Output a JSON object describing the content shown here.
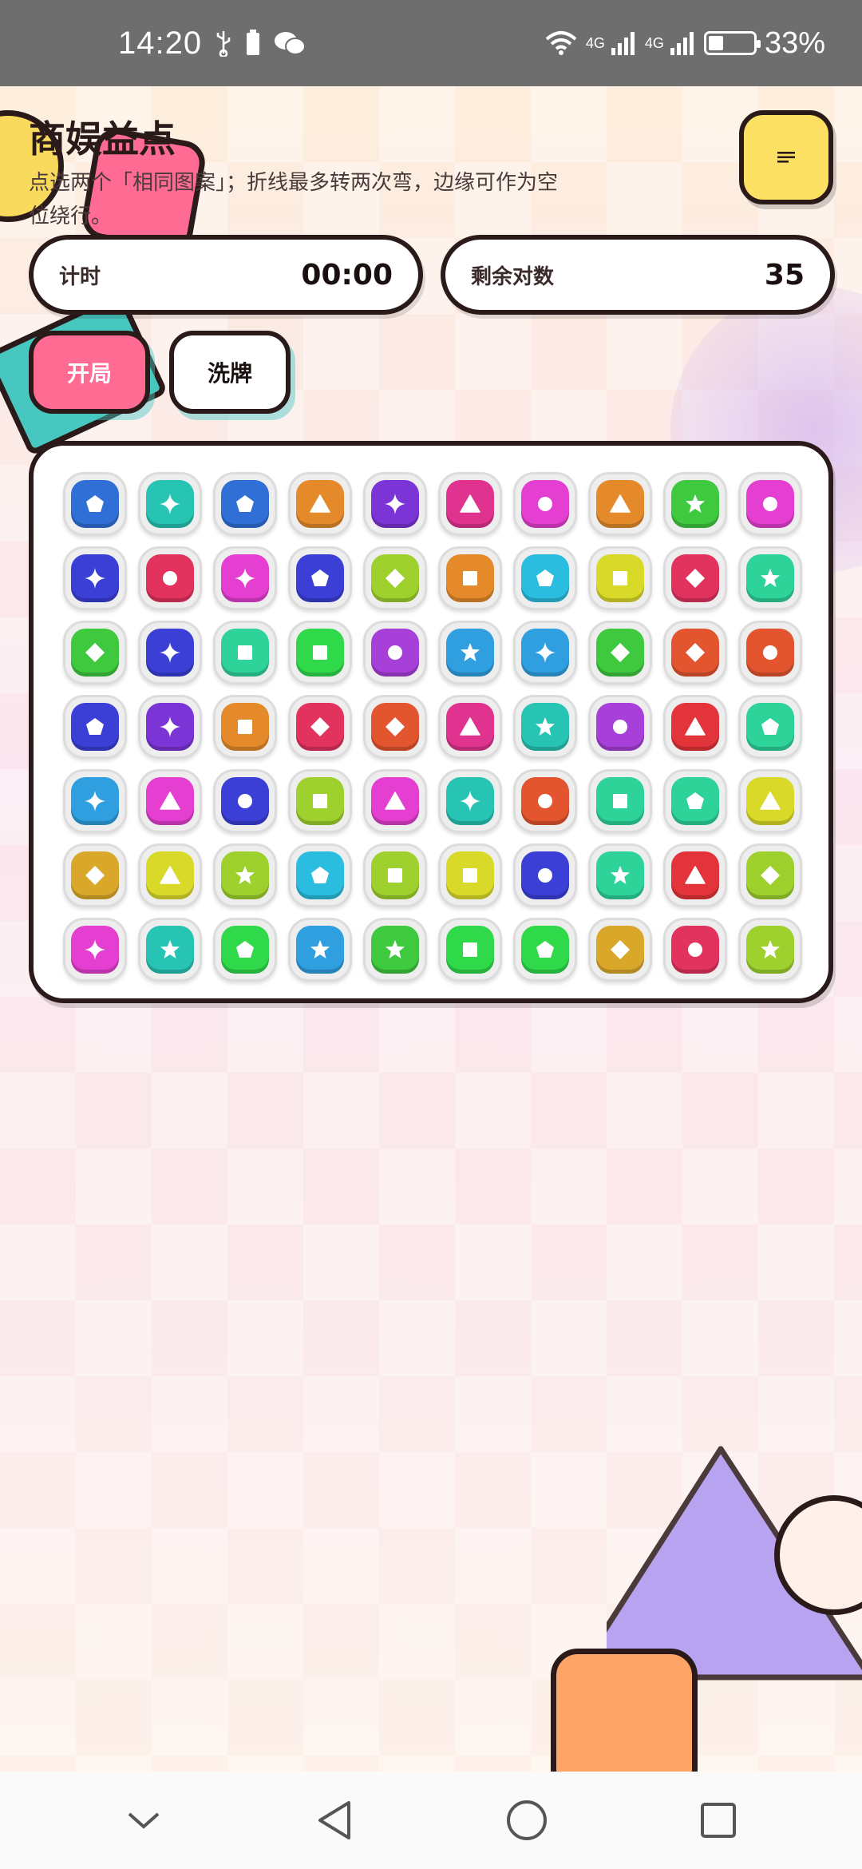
{
  "status_bar": {
    "time": "14:20",
    "network_1": "4G",
    "network_2": "4G",
    "battery_percent": "33%"
  },
  "header": {
    "title": "商娱益点",
    "subtitle": "点选两个「相同图案」；折线最多转两次弯，边缘可作为空位绕行。",
    "menu_icon": "menu-lines-icon"
  },
  "stats": {
    "timer_label": "计时",
    "timer_value": "00:00",
    "pairs_label": "剩余对数",
    "pairs_value": "35"
  },
  "controls": {
    "start_label": "开局",
    "shuffle_label": "洗牌"
  },
  "colors": {
    "blue": "#2f6fd6",
    "teal": "#27c4b4",
    "orange": "#e58a2a",
    "violet": "#7b35d6",
    "magenta": "#e0338f",
    "pink": "#e43fd0",
    "green": "#3fc93f",
    "indigo": "#3b3fd6",
    "red": "#e2335f",
    "purple": "#a740d8",
    "lime": "#9ed12e",
    "cyan": "#2bbde0",
    "yellow": "#d9d92a",
    "mint": "#2ed39a",
    "vermilion": "#e2552f",
    "sky": "#2f9fe0",
    "gold": "#d9a82a",
    "crimson": "#e2343a",
    "kelly": "#2fd94a"
  },
  "board": {
    "rows": [
      [
        [
          "blue",
          "pentagon"
        ],
        [
          "teal",
          "sparkle"
        ],
        [
          "blue",
          "pentagon"
        ],
        [
          "orange",
          "triangle"
        ],
        [
          "violet",
          "sparkle"
        ],
        [
          "magenta",
          "triangle"
        ],
        [
          "pink",
          "circle"
        ],
        [
          "orange",
          "triangle"
        ],
        [
          "green",
          "star"
        ],
        [
          "pink",
          "circle"
        ]
      ],
      [
        [
          "indigo",
          "sparkle"
        ],
        [
          "red",
          "circle"
        ],
        [
          "pink",
          "sparkle"
        ],
        [
          "indigo",
          "pentagon"
        ],
        [
          "lime",
          "diamond"
        ],
        [
          "orange",
          "square"
        ],
        [
          "cyan",
          "pentagon"
        ],
        [
          "yellow",
          "square"
        ],
        [
          "red",
          "diamond"
        ],
        [
          "mint",
          "star"
        ]
      ],
      [
        [
          "green",
          "diamond"
        ],
        [
          "indigo",
          "sparkle"
        ],
        [
          "mint",
          "square"
        ],
        [
          "kelly",
          "square"
        ],
        [
          "purple",
          "circle"
        ],
        [
          "sky",
          "star"
        ],
        [
          "sky",
          "sparkle"
        ],
        [
          "green",
          "diamond"
        ],
        [
          "vermilion",
          "diamond"
        ],
        [
          "vermilion",
          "circle"
        ]
      ],
      [
        [
          "indigo",
          "pentagon"
        ],
        [
          "violet",
          "sparkle"
        ],
        [
          "orange",
          "square"
        ],
        [
          "red",
          "diamond"
        ],
        [
          "vermilion",
          "diamond"
        ],
        [
          "magenta",
          "triangle"
        ],
        [
          "teal",
          "star"
        ],
        [
          "purple",
          "circle"
        ],
        [
          "crimson",
          "triangle"
        ],
        [
          "mint",
          "pentagon"
        ]
      ],
      [
        [
          "sky",
          "sparkle"
        ],
        [
          "pink",
          "triangle"
        ],
        [
          "indigo",
          "circle"
        ],
        [
          "lime",
          "square"
        ],
        [
          "pink",
          "triangle"
        ],
        [
          "teal",
          "sparkle"
        ],
        [
          "vermilion",
          "circle"
        ],
        [
          "mint",
          "square"
        ],
        [
          "mint",
          "pentagon"
        ],
        [
          "yellow",
          "triangle"
        ]
      ],
      [
        [
          "gold",
          "diamond"
        ],
        [
          "yellow",
          "triangle"
        ],
        [
          "lime",
          "star"
        ],
        [
          "cyan",
          "pentagon"
        ],
        [
          "lime",
          "square"
        ],
        [
          "yellow",
          "square"
        ],
        [
          "indigo",
          "circle"
        ],
        [
          "mint",
          "star"
        ],
        [
          "crimson",
          "triangle"
        ],
        [
          "lime",
          "diamond"
        ]
      ],
      [
        [
          "pink",
          "sparkle"
        ],
        [
          "teal",
          "star"
        ],
        [
          "kelly",
          "pentagon"
        ],
        [
          "sky",
          "star"
        ],
        [
          "green",
          "star"
        ],
        [
          "kelly",
          "square"
        ],
        [
          "kelly",
          "pentagon"
        ],
        [
          "gold",
          "diamond"
        ],
        [
          "red",
          "circle"
        ],
        [
          "lime",
          "star"
        ]
      ]
    ]
  },
  "nav": {
    "down_icon": "chevron-down-icon",
    "back_icon": "back-triangle-icon",
    "home_icon": "home-circle-icon",
    "recents_icon": "recents-square-icon"
  }
}
